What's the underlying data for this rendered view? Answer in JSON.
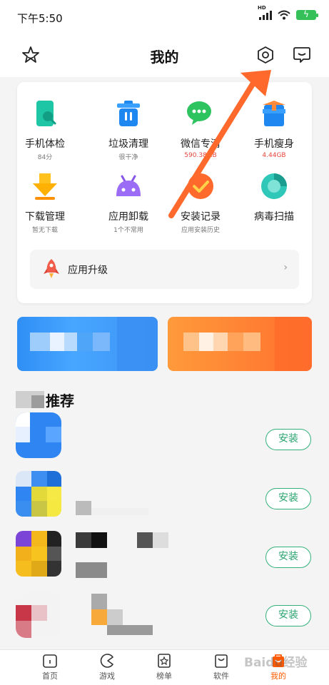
{
  "status_bar": {
    "time": "下午5:50",
    "hd": "HD"
  },
  "header": {
    "title": "我的",
    "favorites_icon": "star-outline-icon",
    "settings_icon": "hexagon-gear-icon",
    "messages_icon": "message-box-icon"
  },
  "tools": [
    {
      "label": "手机体检",
      "sub": "84分",
      "icon": "phone-checkup-icon",
      "sub_color": "#777777"
    },
    {
      "label": "垃圾清理",
      "sub": "很干净",
      "icon": "trash-can-icon",
      "sub_color": "#777777"
    },
    {
      "label": "微信专清",
      "sub": "590.38MB",
      "icon": "wechat-clean-icon",
      "sub_color": "#e8463c"
    },
    {
      "label": "手机瘦身",
      "sub": "4.44GB",
      "icon": "phone-slim-icon",
      "sub_color": "#e8463c"
    },
    {
      "label": "下载管理",
      "sub": "暂无下载",
      "icon": "download-arrow-icon",
      "sub_color": "#777777"
    },
    {
      "label": "应用卸载",
      "sub": "1个不常用",
      "icon": "android-uninstall-icon",
      "sub_color": "#777777"
    },
    {
      "label": "安装记录",
      "sub": "应用安装历史",
      "icon": "install-history-icon",
      "sub_color": "#777777"
    },
    {
      "label": "病毒扫描",
      "sub": "",
      "icon": "virus-scan-icon",
      "sub_color": "#777777"
    }
  ],
  "upgrade": {
    "label": "应用升级",
    "icon": "rocket-icon",
    "chevron": "›"
  },
  "recommend": {
    "title": "推荐",
    "apps": [
      {
        "install_label": "安装"
      },
      {
        "install_label": "安装"
      },
      {
        "install_label": "安装"
      },
      {
        "install_label": "安装"
      }
    ]
  },
  "bottom_nav": [
    {
      "label": "首页",
      "icon": "home-icon",
      "active": false
    },
    {
      "label": "游戏",
      "icon": "gamepad-icon",
      "active": false
    },
    {
      "label": "榜单",
      "icon": "ranking-icon",
      "active": false
    },
    {
      "label": "软件",
      "icon": "software-bag-icon",
      "active": false
    },
    {
      "label": "我的",
      "icon": "profile-bag-icon",
      "active": true
    }
  ],
  "colors": {
    "accent": "#ff5a00",
    "install_green": "#34b17b",
    "annotation_arrow": "#ff6a2c"
  },
  "watermark": "Baidu经验"
}
